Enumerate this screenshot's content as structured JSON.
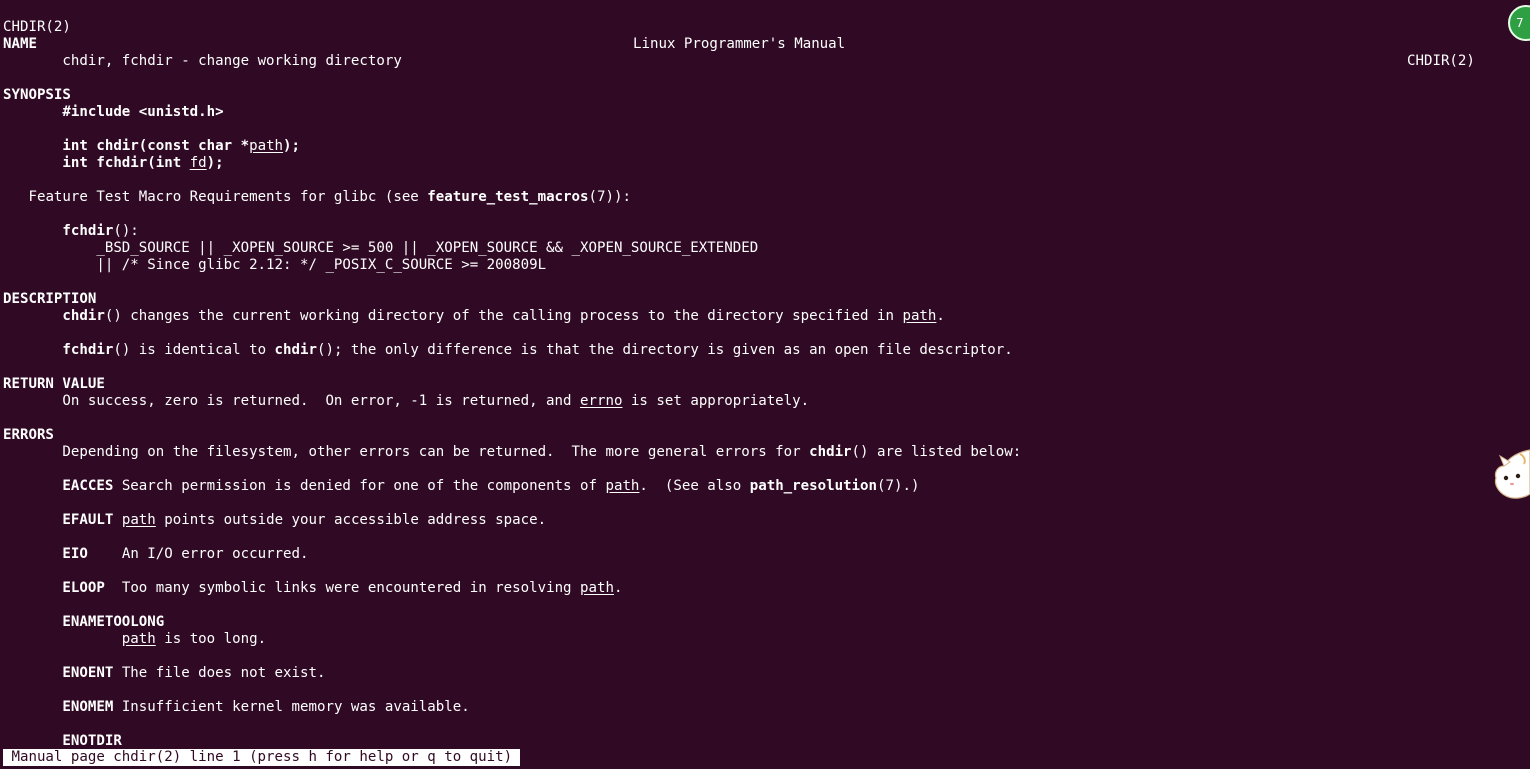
{
  "header": {
    "left": "CHDIR(2)",
    "center": "Linux Programmer's Manual",
    "right": "CHDIR(2)"
  },
  "sections": {
    "name": "NAME",
    "synopsis": "SYNOPSIS",
    "description": "DESCRIPTION",
    "return_value": "RETURN VALUE",
    "errors": "ERRORS"
  },
  "name_text": "chdir, fchdir - change working directory",
  "synopsis": {
    "include": "#include <unistd.h>",
    "chdir_pre": "int chdir(const char *",
    "chdir_arg": "path",
    "chdir_post": ");",
    "fchdir_pre": "int fchdir(int ",
    "fchdir_arg": "fd",
    "fchdir_post": ");",
    "ftm_pre": "Feature Test Macro Requirements for glibc (see ",
    "ftm_link": "feature_test_macros",
    "ftm_post": "(7)):",
    "fchdir_label": "fchdir",
    "fchdir_label_post": "():",
    "macro_line1": "_BSD_SOURCE || _XOPEN_SOURCE >= 500 || _XOPEN_SOURCE && _XOPEN_SOURCE_EXTENDED",
    "macro_line2": "|| /* Since glibc 2.12: */ _POSIX_C_SOURCE >= 200809L"
  },
  "description": {
    "p1_fn": "chdir",
    "p1_mid": "() changes the current working directory of the calling process to the directory specified in ",
    "p1_arg": "path",
    "p1_end": ".",
    "p2_fn": "fchdir",
    "p2_mid": "() is identical to ",
    "p2_fn2": "chdir",
    "p2_end": "(); the only difference is that the directory is given as an open file descriptor."
  },
  "return_value": {
    "pre": "On success, zero is returned.  On error, -1 is returned, and ",
    "errno": "errno",
    "post": " is set appropriately."
  },
  "errors": {
    "intro_pre": "Depending on the filesystem, other errors can be returned.  The more general errors for ",
    "intro_fn": "chdir",
    "intro_post": "() are listed below:",
    "eacces_code": "EACCES",
    "eacces_pre": " Search permission is denied for one of the components of ",
    "eacces_arg": "path",
    "eacces_mid": ".  (See also ",
    "eacces_link": "path_resolution",
    "eacces_post": "(7).)",
    "efault_code": "EFAULT",
    "efault_arg": "path",
    "efault_post": " points outside your accessible address space.",
    "eio_code": "EIO",
    "eio_text": "An I/O error occurred.",
    "eloop_code": "ELOOP",
    "eloop_pre": "Too many symbolic links were encountered in resolving ",
    "eloop_arg": "path",
    "eloop_post": ".",
    "enametoolong_code": "ENAMETOOLONG",
    "enametoolong_arg": "path",
    "enametoolong_post": " is too long.",
    "enoent_code": "ENOENT",
    "enoent_text": " The file does not exist.",
    "enomem_code": "ENOMEM",
    "enomem_text": " Insufficient kernel memory was available.",
    "enotdir_code": "ENOTDIR"
  },
  "status_bar": " Manual page chdir(2) line 1 (press h for help or q to quit)",
  "badge_text": "7",
  "colors": {
    "background": "#300a24",
    "foreground": "#ffffff",
    "status_bg": "#ffffff",
    "badge": "#2ea043"
  }
}
